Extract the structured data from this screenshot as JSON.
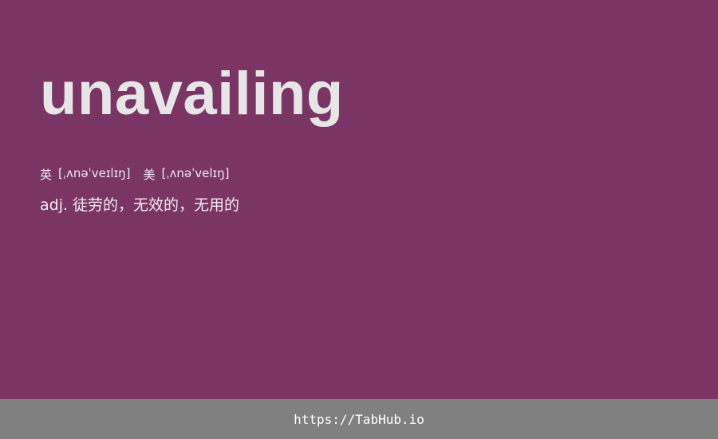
{
  "card": {
    "word": "unavailing",
    "phonetics": {
      "uk_label": "英",
      "uk_ipa": "[ˌʌnəˈveɪlɪŋ]",
      "us_label": "美",
      "us_ipa": "[ˌʌnəˈvelɪŋ]"
    },
    "definition": "adj. 徒劳的，无效的，无用的"
  },
  "footer": {
    "link_text": "https://TabHub.io"
  },
  "colors": {
    "background": "#7b3565",
    "footer_background": "#808080",
    "word_text": "#e6e6e6"
  }
}
